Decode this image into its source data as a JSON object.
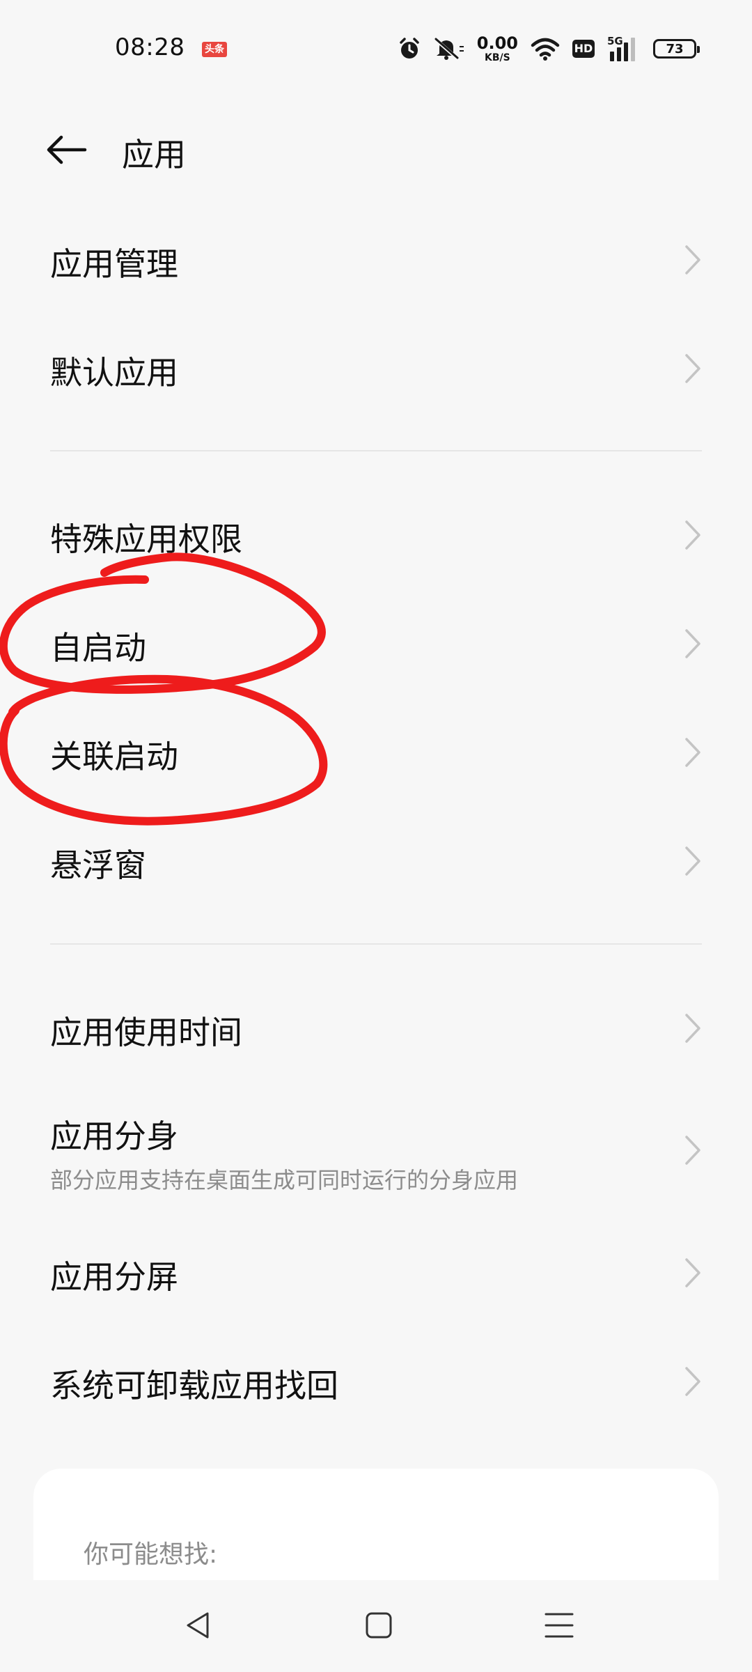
{
  "status_bar": {
    "time": "08:28",
    "app_badge": "头条",
    "net_speed_value": "0.00",
    "net_speed_unit": "KB/S",
    "hd_label": "HD",
    "network_label": "5G",
    "battery_level": "73",
    "icons": [
      "alarm-icon",
      "mute-icon",
      "wifi-icon",
      "hd-icon",
      "signal-icon",
      "battery-icon"
    ]
  },
  "header": {
    "title": "应用",
    "back_icon": "arrow-left-icon"
  },
  "groups": [
    {
      "items": [
        {
          "label": "应用管理"
        },
        {
          "label": "默认应用"
        }
      ]
    },
    {
      "items": [
        {
          "label": "特殊应用权限"
        },
        {
          "label": "自启动"
        },
        {
          "label": "关联启动"
        },
        {
          "label": "悬浮窗"
        }
      ]
    },
    {
      "items": [
        {
          "label": "应用使用时间"
        },
        {
          "label": "应用分身",
          "subtitle": "部分应用支持在桌面生成可同时运行的分身应用"
        },
        {
          "label": "应用分屏"
        },
        {
          "label": "系统可卸载应用找回"
        }
      ]
    }
  ],
  "suggestions": {
    "title": "你可能想找:"
  },
  "nav_bar": {
    "icons": [
      "back-triangle-icon",
      "home-square-icon",
      "menu-lines-icon"
    ]
  },
  "colors": {
    "background": "#f7f7f7",
    "text": "#111111",
    "subtext": "#8c8c8c",
    "chevron": "#c4c4c4",
    "annotation": "#ee1c1c"
  }
}
